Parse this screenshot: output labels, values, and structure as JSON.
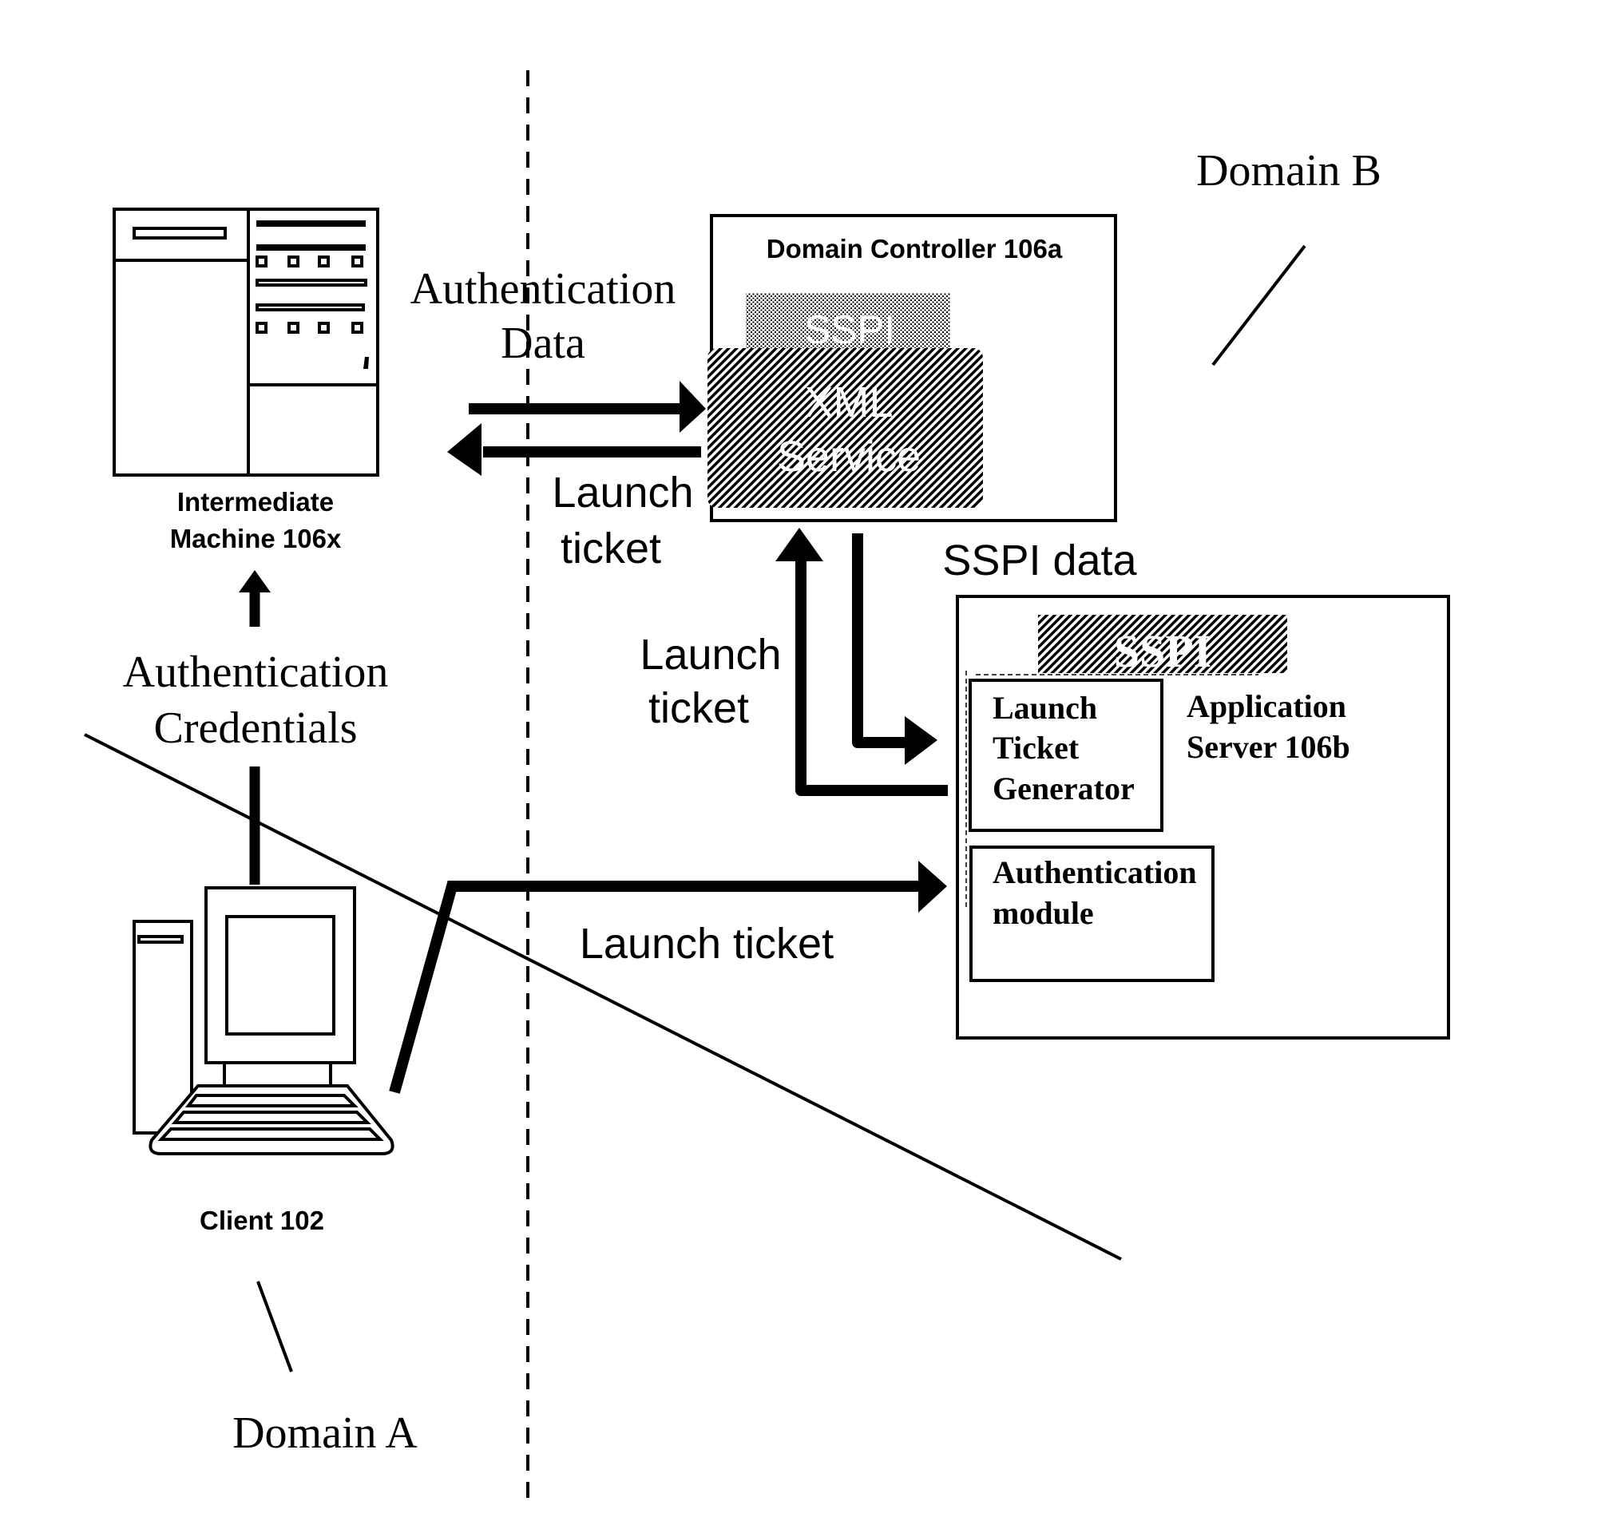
{
  "diagram": {
    "domains": {
      "domain_a": "Domain A",
      "domain_b": "Domain B"
    },
    "nodes": {
      "intermediate_machine": {
        "line1": "Intermediate",
        "line2": "Machine 106x"
      },
      "client": {
        "label": "Client 102"
      },
      "domain_controller": {
        "title": "Domain Controller 106a",
        "sspi_label": "SSPI",
        "xml_service_line1": "XML",
        "xml_service_line2": "Service"
      },
      "application_server": {
        "line1": "Application",
        "line2": "Server 106b",
        "sspi_label": "SSPI",
        "launch_ticket_generator": {
          "line1": "Launch",
          "line2": "Ticket",
          "line3": "Generator"
        },
        "authentication_module": {
          "line1": "Authentication",
          "line2": "module"
        }
      }
    },
    "edges": {
      "authentication_credentials": {
        "line1": "Authentication",
        "line2": "Credentials"
      },
      "authentication_data": {
        "line1": "Authentication",
        "line2": "Data"
      },
      "launch_ticket_to_intermediate": {
        "line1": "Launch",
        "line2": "ticket"
      },
      "launch_ticket_from_app_server": {
        "line1": "Launch",
        "line2": "ticket"
      },
      "sspi_data": {
        "label": "SSPI data"
      },
      "launch_ticket_client_to_app": {
        "label": "Launch ticket"
      }
    }
  }
}
